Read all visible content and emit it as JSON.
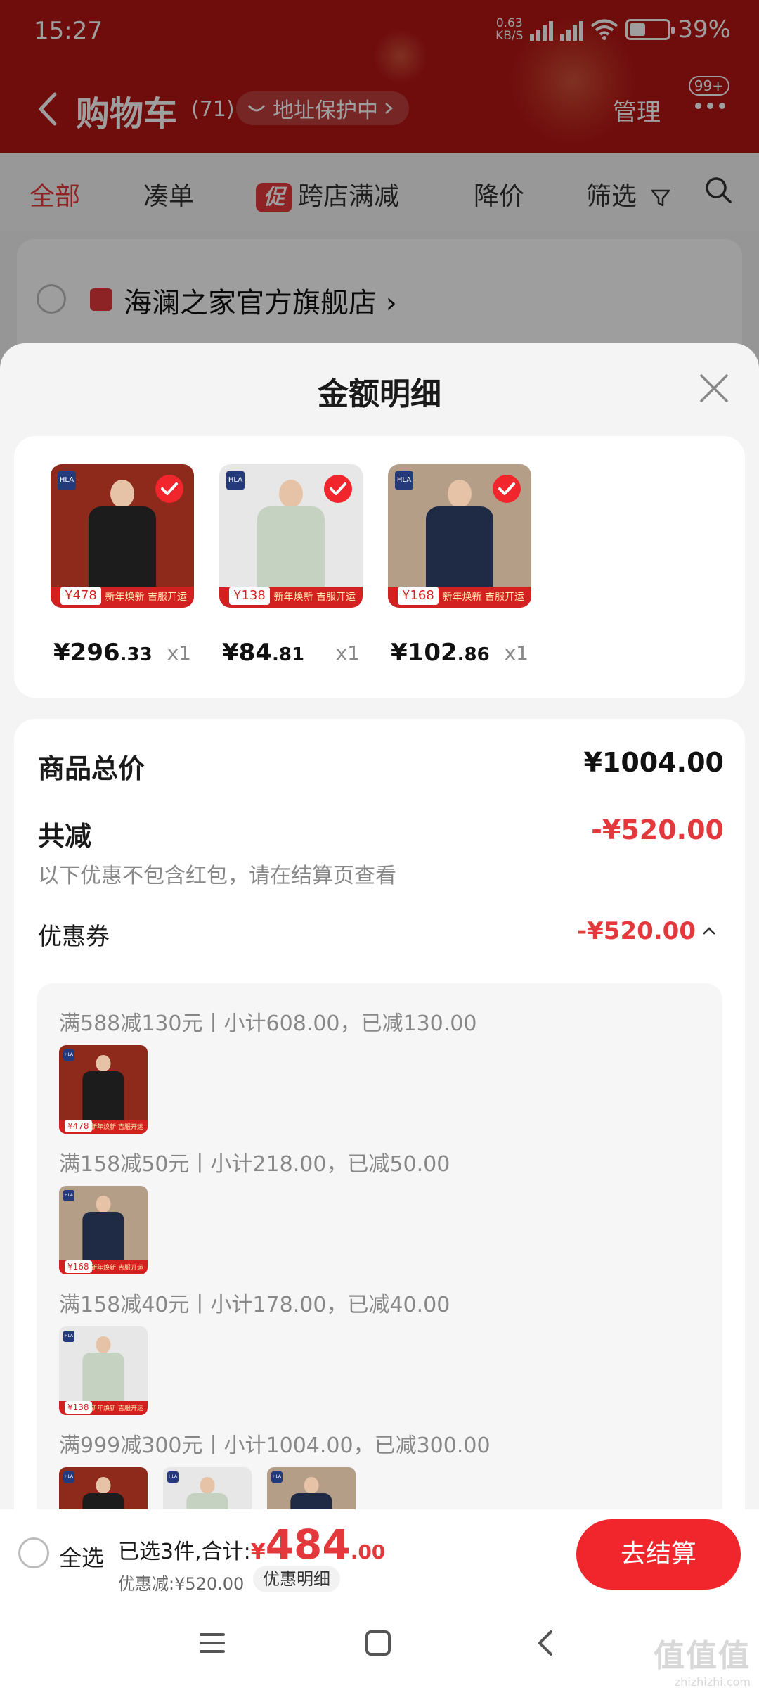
{
  "status_bar": {
    "time": "15:27",
    "net_speed_value": "0.63",
    "net_speed_unit": "KB/S",
    "battery": "39%"
  },
  "nav": {
    "title": "购物车",
    "count": "(71)",
    "address_protection": "地址保护中",
    "manage": "管理",
    "badge": "99+"
  },
  "tabs": [
    {
      "label": "全部",
      "active": true
    },
    {
      "label": "凑单"
    },
    {
      "label": "跨店满减",
      "tag": "促"
    },
    {
      "label": "降价"
    },
    {
      "label": "筛选"
    }
  ],
  "store": {
    "name": "海澜之家官方旗舰店"
  },
  "sheet": {
    "title": "金额明细",
    "items": [
      {
        "price_int": "¥296",
        "price_dec": ".33",
        "qty": "x1",
        "tag": "478",
        "color": "#8d2a1c",
        "garment": "#1c1c1c"
      },
      {
        "price_int": "¥84",
        "price_dec": ".81",
        "qty": "x1",
        "tag": "138",
        "color": "#e7e7e7",
        "garment": "#c5d2c1"
      },
      {
        "price_int": "¥102",
        "price_dec": ".86",
        "qty": "x1",
        "tag": "168",
        "color": "#b59e88",
        "garment": "#1f2a44"
      }
    ],
    "product_total_label": "商品总价",
    "product_total": "¥1004.00",
    "reduce_label": "共减",
    "reduce_total": "-¥520.00",
    "note": "以下优惠不包含红包，请在结算页查看",
    "coupon_label": "优惠券",
    "coupon_total": "-¥520.00",
    "rules": [
      "满588减130元丨小计608.00，已减130.00",
      "满158减50元丨小计218.00，已减50.00",
      "满158减40元丨小计178.00，已减40.00",
      "满999减300元丨小计1004.00，已减300.00"
    ],
    "thumb_promo": "新年焕新 吉服开运",
    "brand": "HLA"
  },
  "bottom_bar": {
    "select_all": "全选",
    "selected_text": "已选3件,合计:",
    "total_yen": "¥",
    "total_int": "484",
    "total_dec": ".00",
    "discount": "优惠减:¥520.00",
    "detail_button": "优惠明细",
    "checkout": "去结算"
  },
  "watermark": {
    "main": "值值值",
    "sub": "zhizhizhi.com"
  },
  "colors": {
    "accent": "#e4393c",
    "header": "#b31414",
    "checkout": "#f0262c"
  }
}
